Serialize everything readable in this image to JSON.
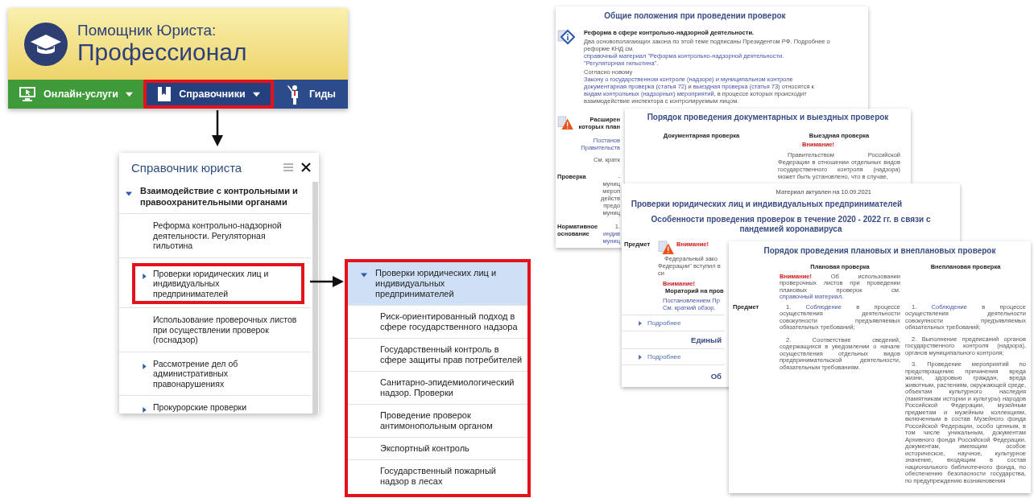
{
  "header": {
    "title_line1": "Помощник Юриста:",
    "title_line2": "Профессионал",
    "nav": [
      {
        "label": "Онлайн-услуги",
        "kind": "services",
        "color": "#3f9b3a",
        "dropdown": true,
        "highlighted": false
      },
      {
        "label": "Справочники",
        "kind": "reference",
        "color": "#24407f",
        "dropdown": true,
        "highlighted": true
      },
      {
        "label": "Гиды",
        "kind": "guides",
        "color": "#2d4a8a",
        "dropdown": false,
        "highlighted": false
      }
    ]
  },
  "sidebar": {
    "title": "Справочник юриста",
    "tree": [
      {
        "label": "Взаимодействие с контрольными и правоохранительными органами",
        "expanded": true,
        "children": [
          {
            "label": "Реформа контрольно-надзорной деятельности. Регуляторная гильотина",
            "kind": "page",
            "highlighted": false
          },
          {
            "label": "Проверки юридических лиц и индивидуальных предпринимателей",
            "kind": "group",
            "highlighted": true
          },
          {
            "label": "Использование проверочных листов при осуществлении проверок (госнадзор)",
            "kind": "page",
            "highlighted": false
          },
          {
            "label": "Рассмотрение дел об административных правонарушениях",
            "kind": "group",
            "highlighted": false
          },
          {
            "label": "Прокурорские проверки",
            "kind": "group",
            "highlighted": false
          }
        ]
      }
    ]
  },
  "expanded_panel": {
    "highlighted": true,
    "node": {
      "label": "Проверки юридических лиц и индивидуальных предпринимателей",
      "expanded": true,
      "selected": true,
      "children": [
        {
          "label": "Риск-ориентированный подход в сфере государственного надзора",
          "selected": false
        },
        {
          "label": "Государственный контроль в сфере защиты прав потребителей",
          "selected": false
        },
        {
          "label": "Санитарно-эпидемиологический надзор. Проверки",
          "selected": false
        },
        {
          "label": "Проведение проверок антимонопольным органом",
          "selected": false
        },
        {
          "label": "Экспортный контроль",
          "selected": false
        },
        {
          "label": "Государственный пожарный надзор в лесах",
          "selected": false
        }
      ]
    }
  },
  "documents": {
    "general_provisions": {
      "title": "Общие положения при проведении проверок",
      "notice": {
        "heading": "Реформа в сфере контрольно-надзорной деятельности.",
        "paragraphs": [
          [
            {
              "kind": "plain",
              "text": "Два основополагающих закона по этой теме подписаны Президентом РФ. Подробнее о реформе КНД см. "
            },
            {
              "kind": "link",
              "text": "справочный материал \"Реформа контрольно-надзорной деятельности."
            },
            {
              "kind": "link",
              "text": "\"Регуляторная гильотина\""
            },
            {
              "kind": "plain",
              "text": "."
            }
          ],
          [
            {
              "kind": "plain",
              "text": "Согласно новому "
            },
            {
              "kind": "link",
              "text": "Закону о государственном контроле (надзоре) и муниципальном контроле"
            },
            {
              "kind": "link",
              "text": "документарная проверка (статья 72)"
            },
            {
              "kind": "plain",
              "text": " и "
            },
            {
              "kind": "link",
              "text": "выездная проверка (статья 73)"
            },
            {
              "kind": "plain",
              "text": " относятся к "
            },
            {
              "kind": "link",
              "text": "видам контрольных (надзорных) мероприятий"
            },
            {
              "kind": "plain",
              "text": ", в процессе которых происходит взаимодействие инспектора с контролируемым лицом."
            }
          ]
        ]
      },
      "warning_fragments": [
        {
          "kind": "bold",
          "text": "Расширен"
        },
        {
          "kind": "bold",
          "text": "которых план"
        },
        {
          "kind": "link",
          "text": "Постанов"
        },
        {
          "kind": "link",
          "text": "Правительств"
        },
        {
          "kind": "plain",
          "text": "См. кратк"
        }
      ],
      "rows": [
        {
          "label": "Проверка",
          "lines": [
            {
              "kind": "plain",
              "text": "-"
            },
            {
              "kind": "plain",
              "text": "муниц"
            },
            {
              "kind": "plain",
              "text": "мероп"
            },
            {
              "kind": "plain",
              "text": "действ"
            },
            {
              "kind": "plain",
              "text": "предо"
            },
            {
              "kind": "plain",
              "text": "муниц"
            }
          ]
        },
        {
          "label": "Нормативное основание",
          "lines": [
            {
              "kind": "plain",
              "text": "1."
            },
            {
              "kind": "link",
              "text": "индив"
            },
            {
              "kind": "link",
              "text": "муниц"
            }
          ]
        }
      ]
    },
    "documentary_and_onsite": {
      "title": "Порядок проведения документарных и выездных проверок",
      "columns": [
        "Документарная проверка",
        "Выездная проверка"
      ],
      "warning": "Внимание!",
      "paragraph": "Правительством Российской Федерации в отношении отдельных видов государственного контроля (надзора) может быть установлено, что в случае,"
    },
    "inspections_overview": {
      "date": "Материал актуален на 10.09.2021",
      "title": "Проверки юридических лиц и индивидуальных предпринимателей",
      "subtitle": "Особенности проведения проверок в течение 2020 - 2022 гг. в связи с пандемией коронавируса",
      "row_label": "Предмет",
      "notice_1": {
        "warning": "Внимание!",
        "line": "Федеральный зако",
        "tail": "Федерации\" вступил в си"
      },
      "notice_2": {
        "warning": "Внимание!",
        "heading": "Мораторий на пров",
        "links": [
          "Постановлением Пр",
          "См. краткий обзор."
        ]
      },
      "sections": [
        {
          "kind": "more",
          "text": "Подробнее"
        },
        {
          "kind": "heading",
          "text": "Единый"
        },
        {
          "kind": "more",
          "text": "Подробнее"
        },
        {
          "kind": "heading",
          "text": "Об"
        }
      ]
    },
    "planned_and_unplanned": {
      "title": "Порядок проведения плановых и внеплановых проверок",
      "columns": [
        "Плановая проверка",
        "Внеплановая проверка"
      ],
      "row_label": "Предмет",
      "notice": [
        {
          "kind": "alert",
          "text": "Внимание!"
        },
        {
          "kind": "plain",
          "text": " Об использовании проверочных листов при проведении плановых проверок см. "
        },
        {
          "kind": "link",
          "text": "справочный материал"
        },
        {
          "kind": "plain",
          "text": "."
        }
      ],
      "planned": [
        [
          {
            "kind": "plain",
            "text": "1. "
          },
          {
            "kind": "link",
            "text": "Соблюдение"
          },
          {
            "kind": "plain",
            "text": " в процессе осуществления деятельности совокупности предъявляемых обязательных требований;"
          }
        ],
        [
          {
            "kind": "plain",
            "text": "2. Соответствие сведений, содержащихся в уведомлении о начале осуществления отдельных видов предпринимательской деятельности, обязательным требованиям."
          }
        ]
      ],
      "unplanned": [
        [
          {
            "kind": "plain",
            "text": "1. "
          },
          {
            "kind": "link",
            "text": "Соблюдение"
          },
          {
            "kind": "plain",
            "text": " в процессе осуществления деятельности совокупности предъявляемых обязательных требований;"
          }
        ],
        [
          {
            "kind": "plain",
            "text": "2. Выполнение предписаний органов государственного контроля (надзора), органов муниципального контроля;"
          }
        ],
        [
          {
            "kind": "plain",
            "text": "3. Проведение мероприятий по предотвращению причинения вреда жизни, здоровью граждан, вреда животным, растениям, окружающей среде, объектам культурного наследия (памятникам истории и культуры) народов Российской Федерации, музейным предметам и музейным коллекциям, включенным в состав Музейного фонда Российской Федерации, особо ценным, в том числе уникальным, документам Архивного фонда Российской Федерации, документам, имеющим особое историческое, научное, культурное значение, входящим в состав национального библиотечного фонда, по обеспечению безопасности государства, по предупреждению возникновения"
          }
        ]
      ]
    }
  }
}
